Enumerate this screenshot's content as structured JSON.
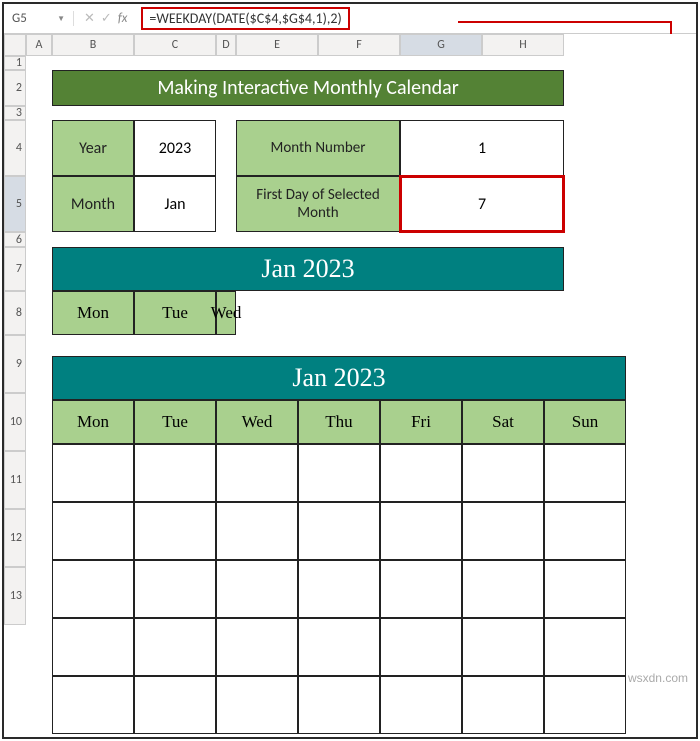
{
  "namebox": "G5",
  "formula": "=WEEKDAY(DATE($C$4,$G$4,1),2)",
  "columns": [
    "A",
    "B",
    "C",
    "D",
    "E",
    "F",
    "G",
    "H"
  ],
  "rows": [
    "1",
    "2",
    "3",
    "4",
    "5",
    "6",
    "7",
    "8",
    "9",
    "10",
    "11",
    "12",
    "13"
  ],
  "title": "Making Interactive Monthly Calendar",
  "labels": {
    "year": "Year",
    "month": "Month",
    "monthnum": "Month Number",
    "firstday": "First Day of Selected Month"
  },
  "vals": {
    "year": "2023",
    "month": "Jan",
    "monthnum": "1",
    "firstday": "7"
  },
  "cal_title": "Jan 2023",
  "days": [
    "Mon",
    "Tue",
    "Wed",
    "Thu",
    "Fri",
    "Sat",
    "Sun"
  ],
  "watermark": "wsxdn.com"
}
